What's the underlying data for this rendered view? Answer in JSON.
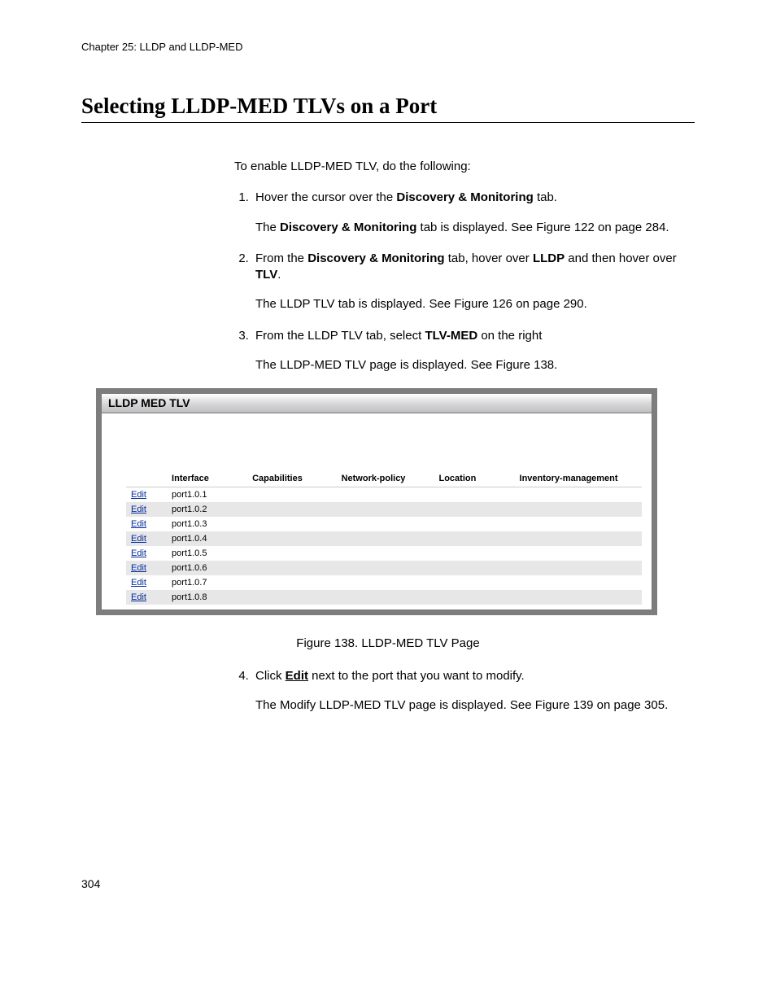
{
  "chapter_header": "Chapter 25: LLDP and LLDP-MED",
  "section_title": "Selecting LLDP-MED TLVs on a Port",
  "intro": "To enable LLDP-MED TLV, do the following:",
  "steps": {
    "s1": {
      "pre": "Hover the cursor over the ",
      "bold1": "Discovery & Monitoring",
      "post": " tab.",
      "sub_pre": "The ",
      "sub_bold": "Discovery & Monitoring",
      "sub_post": " tab is displayed. See Figure 122 on page 284."
    },
    "s2": {
      "pre": "From the ",
      "bold1": "Discovery & Monitoring",
      "mid": " tab, hover over ",
      "bold2": "LLDP",
      "mid2": " and then hover over ",
      "bold3": "TLV",
      "end": ".",
      "sub": "The LLDP TLV tab is displayed. See Figure 126 on page 290."
    },
    "s3": {
      "pre": "From the LLDP TLV tab, select ",
      "bold1": "TLV-MED",
      "post": " on the right",
      "sub": "The LLDP-MED TLV page is displayed. See Figure 138."
    },
    "s4": {
      "pre": "Click ",
      "boldu": "Edit",
      "post": " next to the port that you want to modify.",
      "sub": "The Modify LLDP-MED TLV page is displayed. See Figure 139 on page 305."
    }
  },
  "panel": {
    "title": "LLDP MED TLV",
    "columns": {
      "interface": "Interface",
      "capabilities": "Capabilities",
      "network_policy": "Network-policy",
      "location": "Location",
      "inventory": "Inventory-management"
    },
    "edit_label": "Edit",
    "rows": [
      {
        "interface": "port1.0.1"
      },
      {
        "interface": "port1.0.2"
      },
      {
        "interface": "port1.0.3"
      },
      {
        "interface": "port1.0.4"
      },
      {
        "interface": "port1.0.5"
      },
      {
        "interface": "port1.0.6"
      },
      {
        "interface": "port1.0.7"
      },
      {
        "interface": "port1.0.8"
      }
    ]
  },
  "figure_caption": "Figure 138. LLDP-MED TLV Page",
  "page_number": "304"
}
